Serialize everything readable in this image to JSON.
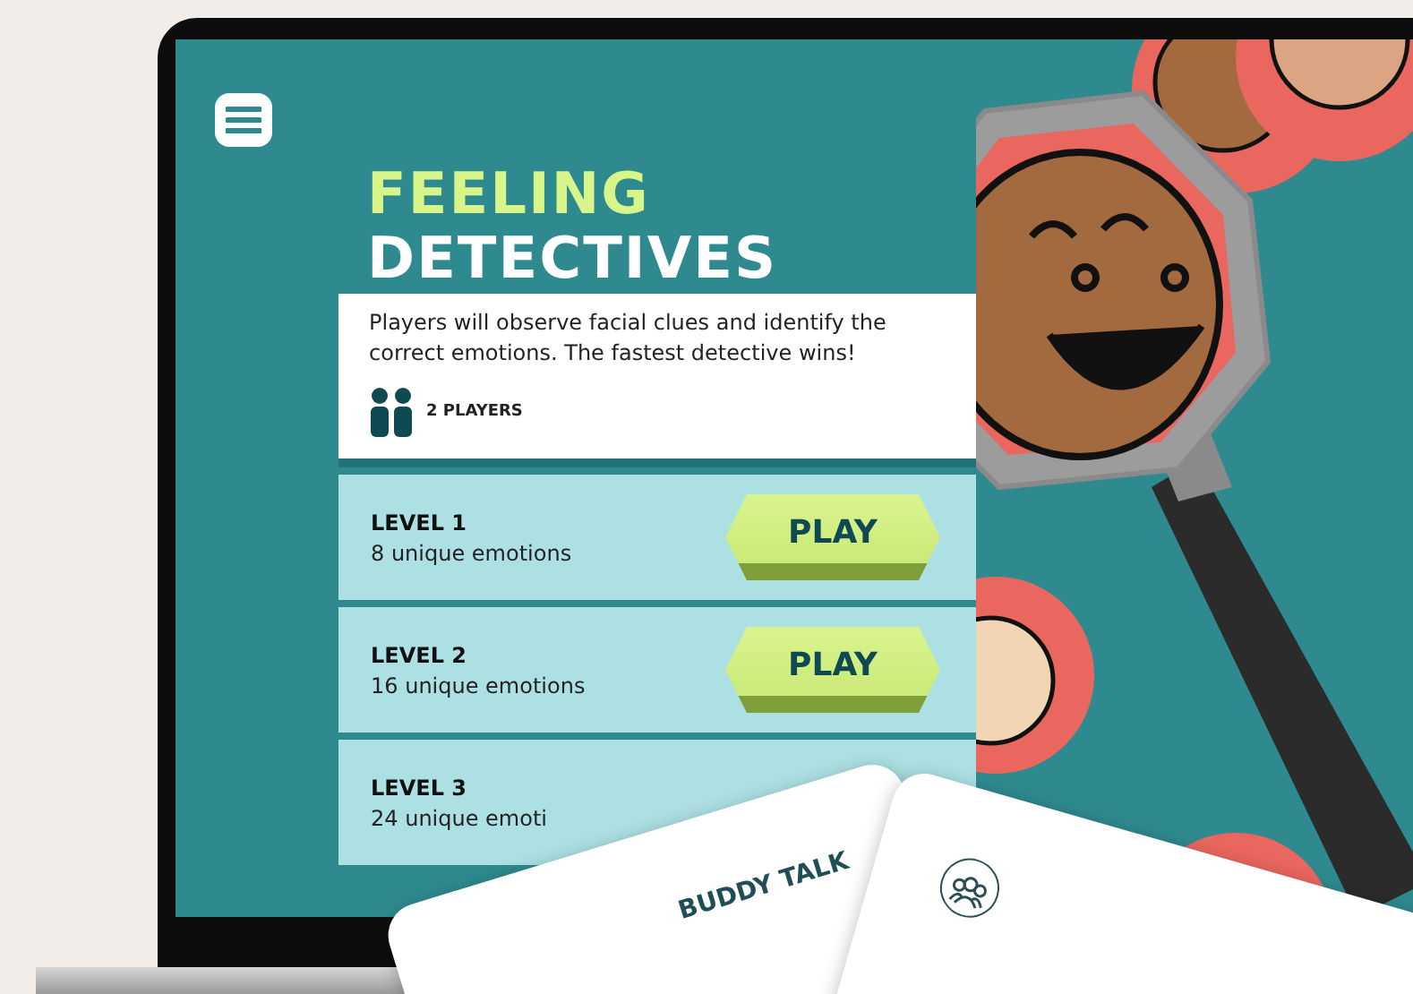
{
  "title": {
    "line_1": "FEELING",
    "line_2": "DETECTIVES"
  },
  "description": "Players will observe facial clues and identify the correct emotions. The fastest detective wins!",
  "players": "2 PLAYERS",
  "levels": [
    {
      "name": "LEVEL 1",
      "detail": "8 unique emotions",
      "button": "PLAY"
    },
    {
      "name": "LEVEL 2",
      "detail": "16 unique emotions",
      "button": "PLAY"
    },
    {
      "name": "LEVEL 3",
      "detail": "24 unique emoti"
    }
  ],
  "cards": [
    {
      "title": "BUDDY TALK"
    }
  ]
}
